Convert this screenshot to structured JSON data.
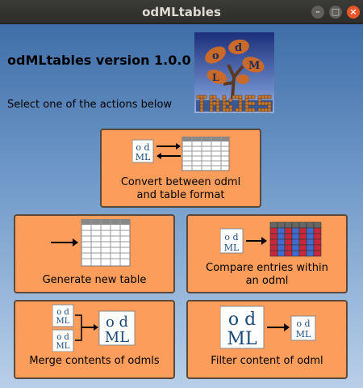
{
  "window": {
    "title": "odMLtables"
  },
  "header": {
    "app_title": "odMLtables version 1.0.0",
    "subtitle": "Select one of the actions below"
  },
  "actions": {
    "convert": {
      "line1": "Convert between odml",
      "line2": "and table format"
    },
    "generate": {
      "label": "Generate new table"
    },
    "compare": {
      "line1": "Compare entries within",
      "line2": "an odml"
    },
    "merge": {
      "label": "Merge contents of odmls"
    },
    "filter": {
      "label": "Filter content of odml"
    }
  },
  "colors": {
    "button_bg": "#fd9d5c",
    "button_border": "#5a4a3c",
    "odml_text": "#1b4a78",
    "compare_blue": "#3f6ccf",
    "compare_red": "#c8283a"
  }
}
